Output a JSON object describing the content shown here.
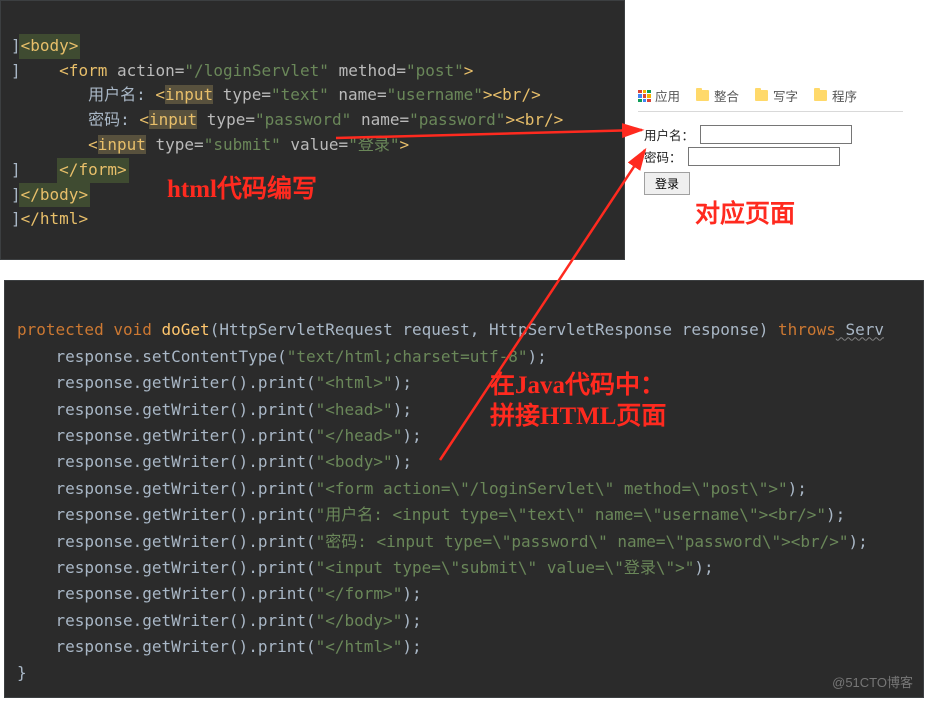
{
  "labels": {
    "html_annot": "html代码编写",
    "page_annot": "对应页面",
    "java_annot_line1": "在Java代码中：",
    "java_annot_line2": "拼接HTML页面"
  },
  "code1": {
    "l1_open": "<body>",
    "l2_form_open": "<form",
    "l2_attr_action": "action=",
    "l2_val_action": "\"/loginServlet\"",
    "l2_attr_method": "method=",
    "l2_val_method": "\"post\"",
    "l2_close": ">",
    "l3_label": "用户名: ",
    "l3_input": "<input",
    "l3_attr_type": "type=",
    "l3_val_type": "\"text\"",
    "l3_attr_name": "name=",
    "l3_val_name": "\"username\"",
    "l3_br": "><br/>",
    "l4_label": "密码: ",
    "l4_input": "<input",
    "l4_attr_type": "type=",
    "l4_val_type": "\"password\"",
    "l4_attr_name": "name=",
    "l4_val_name": "\"password\"",
    "l4_br": "><br/>",
    "l5_input": "<input",
    "l5_attr_type": "type=",
    "l5_val_type": "\"submit\"",
    "l5_attr_value": "value=",
    "l5_val_value": "\"登录\"",
    "l5_close": ">",
    "l6_form_close": "</form>",
    "l7_body_close": "</body>",
    "l8_html_close": "</html>"
  },
  "browser": {
    "apps": "应用",
    "bm1": "整合",
    "bm2": "写字",
    "bm3": "程序",
    "label_user": "用户名：",
    "label_pass": "密码：",
    "submit": "登录"
  },
  "code2": {
    "kw_protected": "protected",
    "kw_void": "void",
    "method": "doGet",
    "sig_rest": "(HttpServletRequest request, HttpServletResponse response) ",
    "kw_throws": "throws",
    "serv": " Serv",
    "lines": [
      {
        "prefix": "    response.setContentType(",
        "str": "\"text/html;charset=utf-8\"",
        "suffix": ");"
      },
      {
        "prefix": "    response.getWriter().print(",
        "str": "\"<html>\"",
        "suffix": ");"
      },
      {
        "prefix": "    response.getWriter().print(",
        "str": "\"<head>\"",
        "suffix": ");"
      },
      {
        "prefix": "    response.getWriter().print(",
        "str": "\"</head>\"",
        "suffix": ");"
      },
      {
        "prefix": "    response.getWriter().print(",
        "str": "\"<body>\"",
        "suffix": ");"
      },
      {
        "prefix": "    response.getWriter().print(",
        "str": "\"<form action=\\\"/loginServlet\\\" method=\\\"post\\\">\"",
        "suffix": ");"
      },
      {
        "prefix": "    response.getWriter().print(",
        "str": "\"用户名: <input type=\\\"text\\\" name=\\\"username\\\"><br/>\"",
        "suffix": ");"
      },
      {
        "prefix": "    response.getWriter().print(",
        "str": "\"密码: <input type=\\\"password\\\" name=\\\"password\\\"><br/>\"",
        "suffix": ");"
      },
      {
        "prefix": "    response.getWriter().print(",
        "str": "\"<input type=\\\"submit\\\" value=\\\"登录\\\">\"",
        "suffix": ");"
      },
      {
        "prefix": "    response.getWriter().print(",
        "str": "\"</form>\"",
        "suffix": ");"
      },
      {
        "prefix": "    response.getWriter().print(",
        "str": "\"</body>\"",
        "suffix": ");"
      },
      {
        "prefix": "    response.getWriter().print(",
        "str": "\"</html>\"",
        "suffix": ");"
      }
    ],
    "close_brace": "}"
  },
  "watermark": "@51CTO博客"
}
